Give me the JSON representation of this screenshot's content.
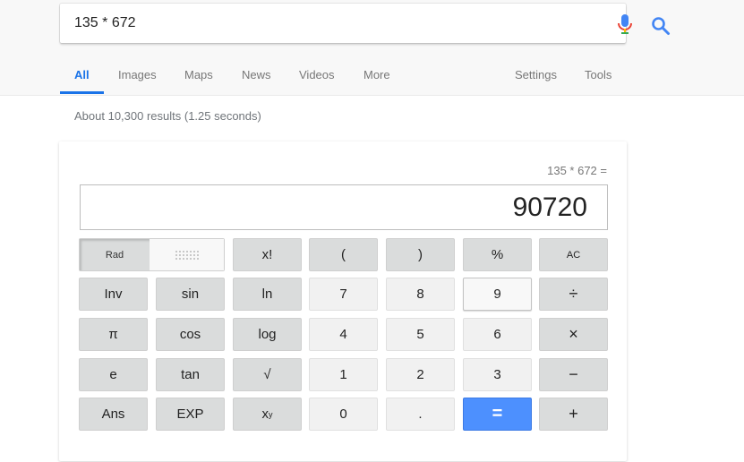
{
  "search": {
    "query": "135 * 672",
    "mic_icon": "microphone-icon",
    "search_icon": "magnifier-icon",
    "accent_color": "#4285f4"
  },
  "nav": {
    "tabs": [
      {
        "label": "All",
        "active": true
      },
      {
        "label": "Images"
      },
      {
        "label": "Maps"
      },
      {
        "label": "News"
      },
      {
        "label": "Videos"
      },
      {
        "label": "More"
      }
    ],
    "settings": "Settings",
    "tools": "Tools"
  },
  "stats": "About 10,300 results (1.25 seconds)",
  "calculator": {
    "expression": "135 * 672 =",
    "result": "90720",
    "rad_label": "Rad",
    "deg_icon": "deg-dots-icon",
    "keys": {
      "factorial": "x!",
      "lparen": "(",
      "rparen": ")",
      "percent": "%",
      "ac": "AC",
      "inv": "Inv",
      "sin": "sin",
      "ln": "ln",
      "seven": "7",
      "eight": "8",
      "nine": "9",
      "divide": "÷",
      "pi": "π",
      "cos": "cos",
      "log": "log",
      "four": "4",
      "five": "5",
      "six": "6",
      "multiply": "×",
      "e": "e",
      "tan": "tan",
      "sqrt": "√",
      "one": "1",
      "two": "2",
      "three": "3",
      "minus": "−",
      "ans": "Ans",
      "exp": "EXP",
      "power_base": "x",
      "power_exp": "y",
      "zero": "0",
      "dot": ".",
      "equals": "=",
      "plus": "+"
    }
  }
}
